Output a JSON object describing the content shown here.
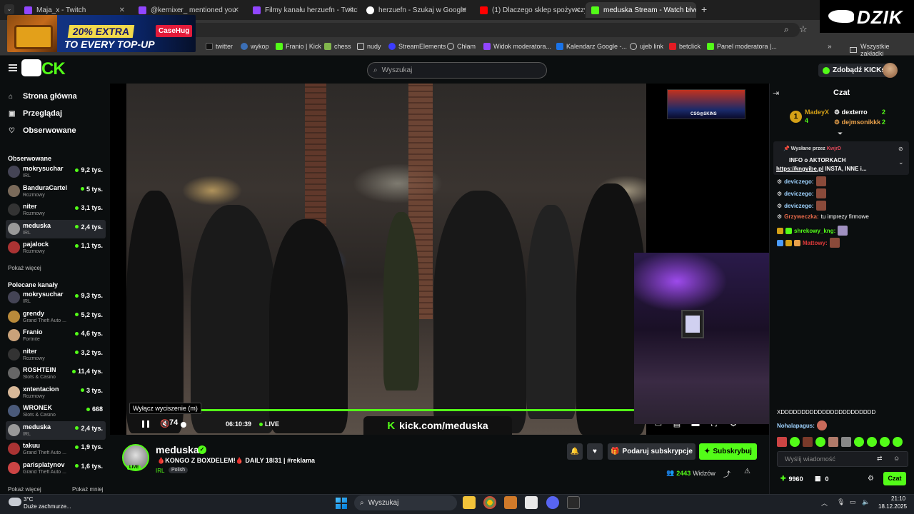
{
  "browser": {
    "tabs": [
      {
        "title": "Maja_x - Twitch",
        "color": "#9146ff"
      },
      {
        "title": "@kernixer_ mentioned you",
        "color": "#9146ff"
      },
      {
        "title": "Filmy kanału herzuefn - Twitch",
        "color": "#9146ff"
      },
      {
        "title": "herzuefn - Szukaj w Google",
        "color": "#4285f4"
      },
      {
        "title": "(1) Dlaczego sklep spożywczy u",
        "color": "#ff0000"
      },
      {
        "title": "meduska Stream - Watch Live o",
        "color": "#53fc18"
      }
    ],
    "new_tab": "+",
    "bookmarks": [
      {
        "label": "twitter",
        "color": "#222"
      },
      {
        "label": "wykop",
        "color": "#3b6fb6"
      },
      {
        "label": "Franio | Kick",
        "color": "#53fc18"
      },
      {
        "label": "chess",
        "color": "#81b64c"
      },
      {
        "label": "nudy",
        "color": "#bbbbbb"
      },
      {
        "label": "StreamElements",
        "color": "#3c3cff"
      },
      {
        "label": "Chłam",
        "color": "#bbbbbb"
      },
      {
        "label": "Widok moderatora...",
        "color": "#9146ff"
      },
      {
        "label": "Kalendarz Google -...",
        "color": "#1a73e8"
      },
      {
        "label": "ujeb link",
        "color": "#bbbbbb"
      },
      {
        "label": "betclick",
        "color": "#e31b23"
      },
      {
        "label": "Panel moderatora |...",
        "color": "#53fc18"
      }
    ],
    "bookmarks_all": "Wszystkie zakładki"
  },
  "promo": {
    "top": "20% EXTRA",
    "bottom": "TO EVERY TOP-UP",
    "brand": "CaseHug"
  },
  "overlay_logo": "DZIK",
  "kick": {
    "search_placeholder": "Wyszukaj",
    "kicks_button": "Zdobądź KICKs",
    "nav": [
      {
        "label": "Strona główna",
        "icon": "⌂"
      },
      {
        "label": "Przeglądaj",
        "icon": "▣"
      },
      {
        "label": "Obserwowane",
        "icon": "♡"
      }
    ],
    "followed_heading": "Obserwowane",
    "followed": [
      {
        "name": "mokrysuchar",
        "category": "IRL",
        "viewers": "9,2 tys.",
        "color": "#445"
      },
      {
        "name": "BanduraCartel",
        "category": "Rozmowy",
        "viewers": "5 tys.",
        "color": "#7a6a5a"
      },
      {
        "name": "niter",
        "category": "Rozmowy",
        "viewers": "3,1 tys.",
        "color": "#333"
      },
      {
        "name": "meduska",
        "category": "IRL",
        "viewers": "2,4 tys.",
        "color": "#999",
        "selected": true
      },
      {
        "name": "pajalock",
        "category": "Rozmowy",
        "viewers": "1,1 tys.",
        "color": "#a33"
      }
    ],
    "show_more": "Pokaż więcej",
    "recommended_heading": "Polecane kanały",
    "recommended": [
      {
        "name": "mokrysuchar",
        "category": "IRL",
        "viewers": "9,3 tys.",
        "color": "#445"
      },
      {
        "name": "grendy",
        "category": "Grand Theft Auto ...",
        "viewers": "5,2 tys.",
        "color": "#b98a3a"
      },
      {
        "name": "Franio",
        "category": "Fortnite",
        "viewers": "4,6 tys.",
        "color": "#c9a27a"
      },
      {
        "name": "niter",
        "category": "Rozmowy",
        "viewers": "3,2 tys.",
        "color": "#333"
      },
      {
        "name": "ROSHTEIN",
        "category": "Slots & Casino",
        "viewers": "11,4 tys.",
        "color": "#666"
      },
      {
        "name": "xntentacion",
        "category": "Rozmowy",
        "viewers": "3 tys.",
        "color": "#d8b898"
      },
      {
        "name": "WRONEK",
        "category": "Slots & Casino",
        "viewers": "668",
        "color": "#4a5a7a"
      },
      {
        "name": "meduska",
        "category": "IRL",
        "viewers": "2,4 tys.",
        "color": "#999",
        "selected": true
      },
      {
        "name": "takuu",
        "category": "Grand Theft Auto ...",
        "viewers": "1,9 tys.",
        "color": "#a33"
      },
      {
        "name": "parisplatynov",
        "category": "Grand Theft Auto ...",
        "viewers": "1,6 tys.",
        "color": "#c44"
      }
    ],
    "show_more_2": "Pokaż więcej",
    "show_less": "Pokaż mniej"
  },
  "player": {
    "tooltip": "Wyłącz wyciszenie (m)",
    "volume": "74",
    "time": "06:10:39",
    "live": "LIVE",
    "watermark": "kick.com/meduska",
    "progress": 1.0
  },
  "stream": {
    "name": "meduska",
    "live_badge": "LIVE",
    "title": "🩸KONGO Z BOXDELEM!🩸 DAILY 18/31 | #reklama",
    "category": "IRL",
    "language": "Polish",
    "gift_label": "Podaruj subskrypcje",
    "subscribe_label": "Subskrybuj",
    "viewers": "2443",
    "viewers_label": "Widzów"
  },
  "chat": {
    "title": "Czat",
    "leaderboard": [
      {
        "rank": "1",
        "name": "MadeyX",
        "count": "4",
        "color": "#d4a017"
      },
      {
        "name": "dexterro",
        "count": "2",
        "color": "#ffffff"
      },
      {
        "name": "dejmsonikkk",
        "count": "2",
        "color": "#e8a04a"
      }
    ],
    "pinned_by_label": "Wysłane przez",
    "pinned_by": "KwjrD",
    "pinned_title": "INFO o AKTORKACH",
    "pinned_link": "https://kngvibe.pl",
    "pinned_rest": " INSTA, INNE i...",
    "messages": [
      {
        "user": "deviczego:",
        "text": "",
        "color": "#9fd3ff"
      },
      {
        "user": "deviczego:",
        "text": "",
        "color": "#9fd3ff"
      },
      {
        "user": "deviczego:",
        "text": "",
        "color": "#9fd3ff"
      },
      {
        "user": "Grzyweczka:",
        "text": "tu imprezy firmowe",
        "color": "#e86a4a"
      },
      {
        "user": "shrekowy_kng:",
        "text": "",
        "color": "#53fc18"
      },
      {
        "user": "Mattowy:",
        "text": "",
        "color": "#e03a3a"
      }
    ],
    "spam_text": "XDDDDDDDDDDDDDDDDDDDDDDD",
    "last_user": "Nohalapagus:",
    "input_placeholder": "Wyślij wiadomość",
    "points": "9960",
    "boxes": "0",
    "send_label": "Czat"
  },
  "taskbar": {
    "temperature": "3°C",
    "weather": "Duże zachmurze...",
    "search": "Wyszukaj",
    "time": "21:10",
    "date": "18.12.2025"
  }
}
